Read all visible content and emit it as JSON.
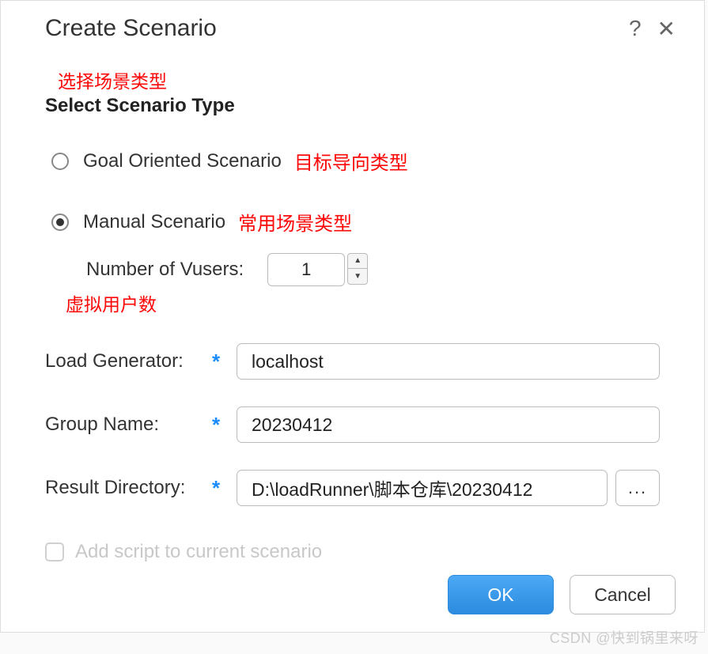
{
  "dialog": {
    "title": "Create Scenario"
  },
  "annotations": {
    "select_type": "选择场景类型",
    "goal_oriented": "目标导向类型",
    "manual": "常用场景类型",
    "vusers": "虚拟用户数"
  },
  "section": {
    "title": "Select Scenario Type"
  },
  "scenario": {
    "goal_label": "Goal Oriented Scenario",
    "manual_label": "Manual Scenario",
    "selected": "manual"
  },
  "vusers": {
    "label": "Number of Vusers:",
    "value": "1"
  },
  "fields": {
    "load_generator": {
      "label": "Load Generator:",
      "value": "localhost"
    },
    "group_name": {
      "label": "Group Name:",
      "value": "20230412"
    },
    "result_dir": {
      "label": "Result Directory:",
      "value": "D:\\loadRunner\\脚本仓库\\20230412"
    },
    "browse_label": "..."
  },
  "add_script": {
    "label": "Add script to current scenario",
    "enabled": false
  },
  "buttons": {
    "ok": "OK",
    "cancel": "Cancel"
  },
  "required_marker": "*",
  "watermark": "CSDN @快到锅里来呀"
}
